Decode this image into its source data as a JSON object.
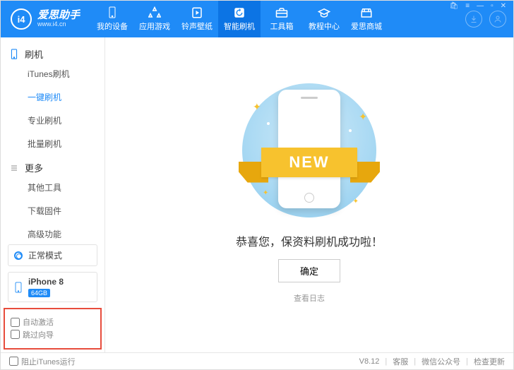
{
  "brand": {
    "logo_letters": "i4",
    "name": "爱思助手",
    "site": "www.i4.cn"
  },
  "tabs": [
    {
      "id": "device",
      "label": "我的设备"
    },
    {
      "id": "apps",
      "label": "应用游戏"
    },
    {
      "id": "ring",
      "label": "铃声壁纸"
    },
    {
      "id": "flash",
      "label": "智能刷机"
    },
    {
      "id": "toolbox",
      "label": "工具箱"
    },
    {
      "id": "tutorial",
      "label": "教程中心"
    },
    {
      "id": "mall",
      "label": "爱思商城"
    }
  ],
  "active_tab": "flash",
  "sidebar": {
    "groups": [
      {
        "title": "刷机",
        "icon": "phone",
        "items": [
          {
            "id": "itunes",
            "label": "iTunes刷机"
          },
          {
            "id": "onekey",
            "label": "一键刷机"
          },
          {
            "id": "pro",
            "label": "专业刷机"
          },
          {
            "id": "batch",
            "label": "批量刷机"
          }
        ]
      },
      {
        "title": "更多",
        "icon": "menu",
        "items": [
          {
            "id": "other",
            "label": "其他工具"
          },
          {
            "id": "fw",
            "label": "下载固件"
          },
          {
            "id": "adv",
            "label": "高级功能"
          }
        ]
      }
    ],
    "active_item": "onekey",
    "mode": {
      "label": "正常模式"
    },
    "device": {
      "name": "iPhone 8",
      "capacity": "64GB"
    },
    "bottom": {
      "auto_activate": "自动激活",
      "skip_guide": "跳过向导"
    }
  },
  "main": {
    "ribbon": "NEW",
    "success": "恭喜您，保资料刷机成功啦！",
    "ok": "确定",
    "view_log": "查看日志"
  },
  "footer": {
    "block_itunes": "阻止iTunes运行",
    "version": "V8.12",
    "support": "客服",
    "wechat": "微信公众号",
    "update": "检查更新"
  }
}
